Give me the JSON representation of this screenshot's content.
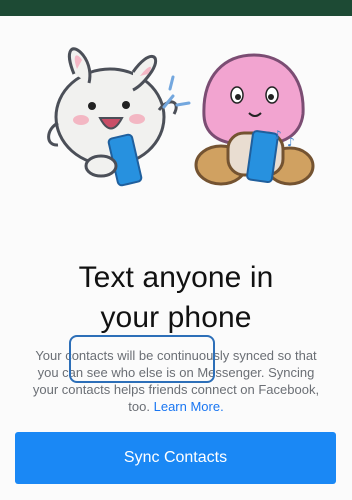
{
  "status_bar": {
    "color": "#1d4a34"
  },
  "illustration": {
    "icon": "two-messenger-stickers-holding-phones"
  },
  "headline": {
    "line1": "Text anyone in",
    "line2": "your phone"
  },
  "body": {
    "line1": "Your contacts will be continuously synced so that",
    "line2": "you can see who else is on Messenger. Syncing",
    "line3": "your contacts helps friends connect on Facebook,",
    "line4_prefix": "too.",
    "learn_more": "Learn More."
  },
  "button": {
    "label": "Sync Contacts",
    "color": "#1a88f5"
  },
  "colors": {
    "link": "#1976f2",
    "annotation": "#2d6fb8"
  }
}
